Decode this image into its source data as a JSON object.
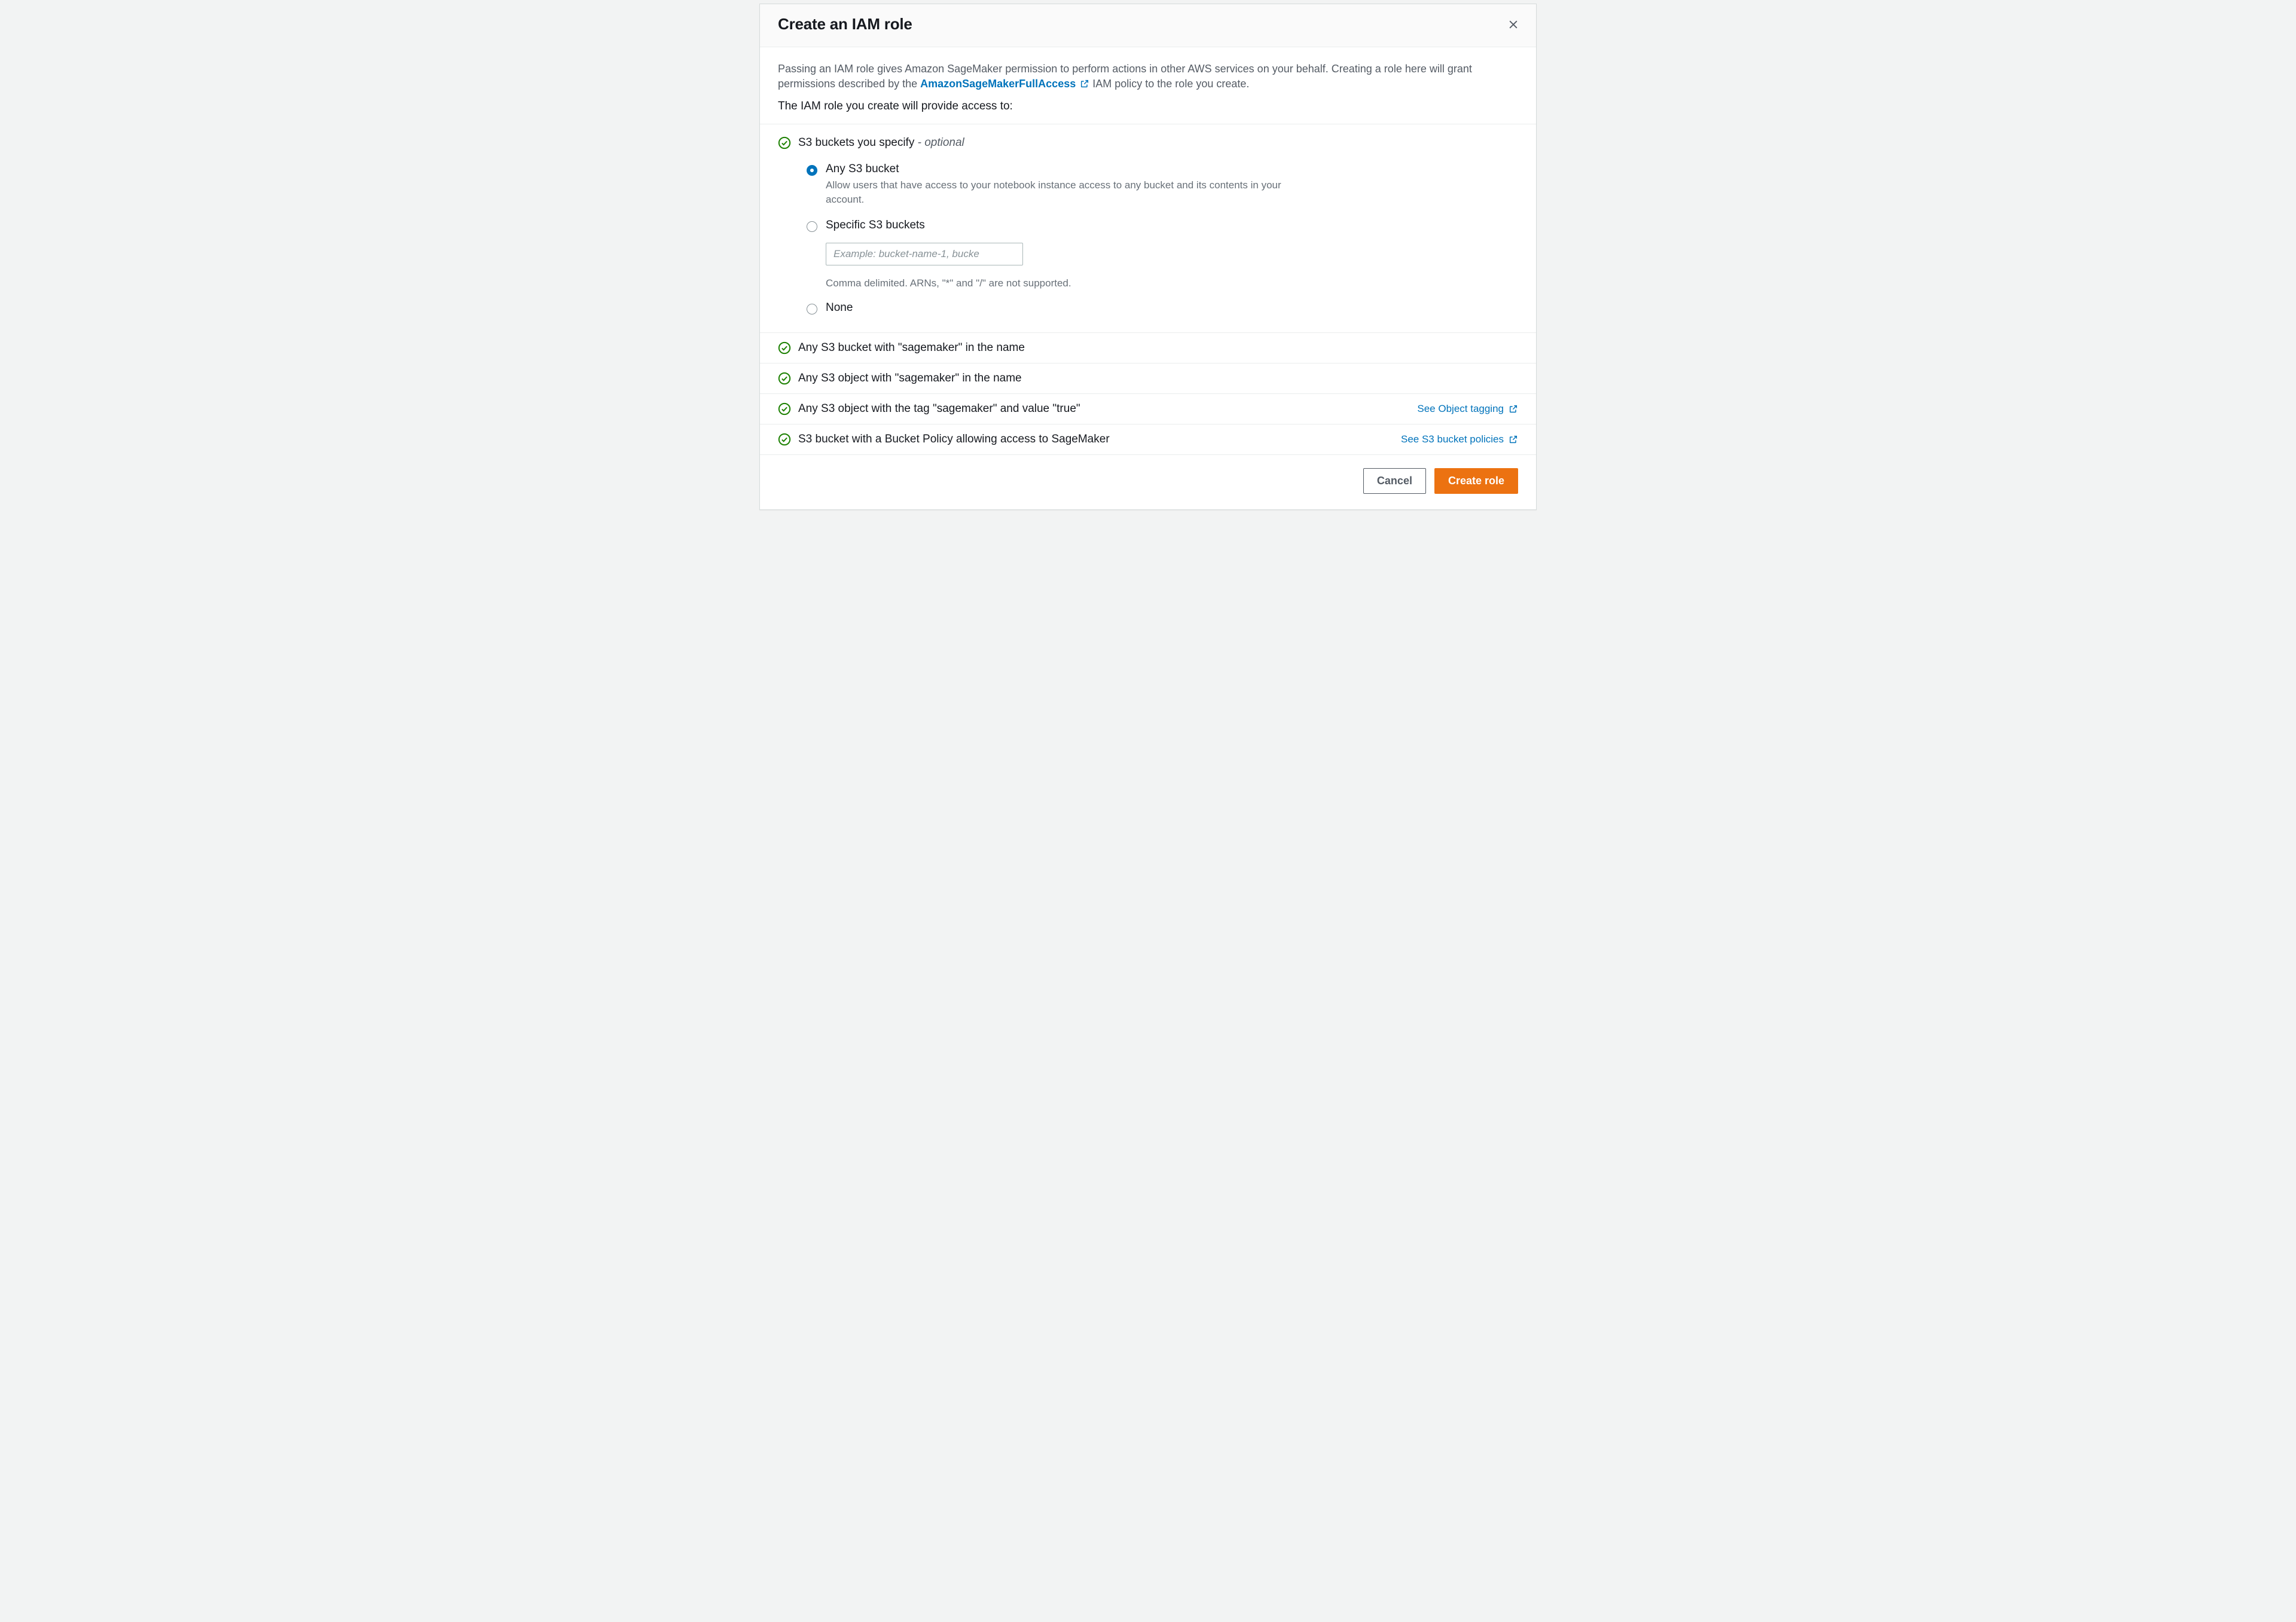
{
  "header": {
    "title": "Create an IAM role"
  },
  "intro": {
    "text_before_link": "Passing an IAM role gives Amazon SageMaker permission to perform actions in other AWS services on your behalf. Creating a role here will grant permissions described by the ",
    "link_text": "AmazonSageMakerFullAccess",
    "text_after_link": " IAM policy to the role you create."
  },
  "subheading": "The IAM role you create will provide access to:",
  "s3_specify": {
    "title_main": "S3 buckets you specify ",
    "title_optional": "- optional",
    "options": {
      "any": {
        "label": "Any S3 bucket",
        "desc": "Allow users that have access to your notebook instance access to any bucket and its contents in your account.",
        "selected": true
      },
      "specific": {
        "label": "Specific S3 buckets",
        "placeholder": "Example: bucket-name-1, bucke",
        "hint": "Comma delimited. ARNs, \"*\" and \"/\" are not supported.",
        "selected": false
      },
      "none": {
        "label": "None",
        "selected": false
      }
    }
  },
  "rows": [
    {
      "label": "Any S3 bucket with \"sagemaker\" in the name",
      "link": null
    },
    {
      "label": "Any S3 object with \"sagemaker\" in the name",
      "link": null
    },
    {
      "label": "Any S3 object with the tag \"sagemaker\" and value \"true\"",
      "link": "See Object tagging"
    },
    {
      "label": "S3 bucket with a Bucket Policy allowing access to SageMaker",
      "link": "See S3 bucket policies"
    }
  ],
  "footer": {
    "cancel": "Cancel",
    "create": "Create role"
  }
}
